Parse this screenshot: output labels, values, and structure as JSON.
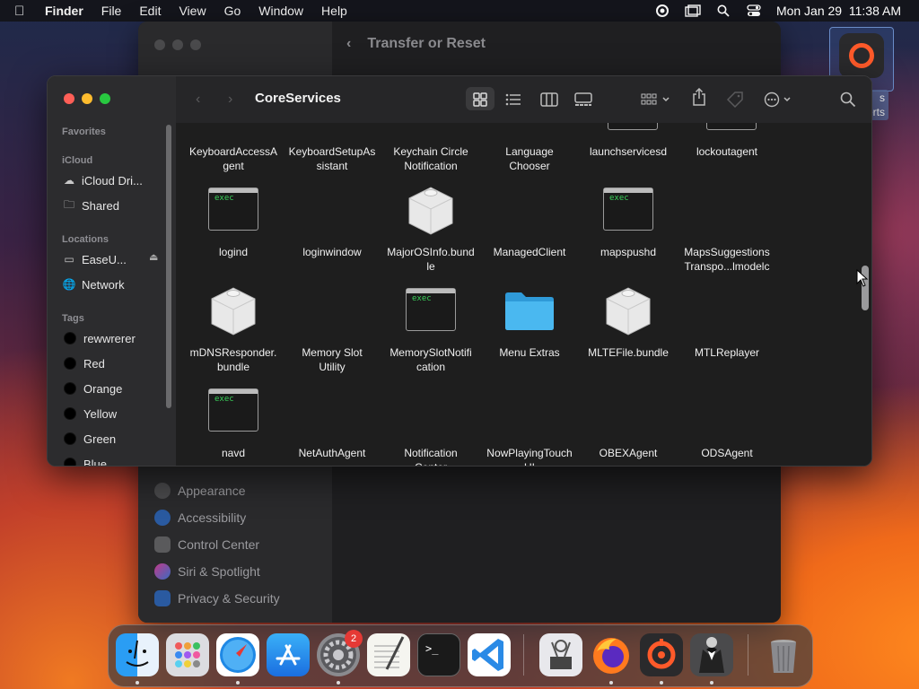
{
  "menubar": {
    "app": "Finder",
    "items": [
      "File",
      "Edit",
      "View",
      "Go",
      "Window",
      "Help"
    ],
    "datetime": "Mon Jan 29  11:38 AM"
  },
  "settings_window": {
    "header": "Transfer or Reset",
    "items": [
      "Appearance",
      "Accessibility",
      "Control Center",
      "Siri & Spotlight",
      "Privacy & Security"
    ]
  },
  "desktop_icon": {
    "label_line1": "s",
    "label_line2": "erts"
  },
  "finder": {
    "title": "CoreServices",
    "sidebar": {
      "favorites_header": "Favorites",
      "icloud_header": "iCloud",
      "icloud_items": [
        "iCloud Dri...",
        "Shared"
      ],
      "locations_header": "Locations",
      "location_items": [
        "EaseU...",
        "Network"
      ],
      "tags_header": "Tags",
      "tags": [
        "rewwrerer",
        "Red",
        "Orange",
        "Yellow",
        "Green",
        "Blue"
      ]
    },
    "rows": [
      [
        "KeyboardAccessAgent",
        "KeyboardSetupAssistant",
        "Keychain Circle Notification",
        "Language Chooser",
        "launchservicesd",
        "lockoutagent"
      ],
      [
        "logind",
        "loginwindow",
        "MajorOSInfo.bundle",
        "ManagedClient",
        "mapspushd",
        "MapsSuggestionsTranspo...lmodelc"
      ],
      [
        "mDNSResponder.bundle",
        "Memory Slot Utility",
        "MemorySlotNotification",
        "Menu Extras",
        "MLTEFile.bundle",
        "MTLReplayer"
      ],
      [
        "navd",
        "NetAuthAgent",
        "Notification Center",
        "NowPlayingTouchUI",
        "OBEXAgent",
        "ODSAgent"
      ]
    ],
    "row_labels": [
      [
        "KeyboardAccessA\ngent",
        "KeyboardSetupAs\nsistant",
        "Keychain Circle\nNotification",
        "Language\nChooser",
        "launchservicesd",
        "lockoutagent"
      ],
      [
        "logind",
        "loginwindow",
        "MajorOSInfo.bund\nle",
        "ManagedClient",
        "mapspushd",
        "MapsSuggestions\nTranspo...lmodelc"
      ],
      [
        "mDNSResponder.\nbundle",
        "Memory Slot\nUtility",
        "MemorySlotNotifi\ncation",
        "Menu Extras",
        "MLTEFile.bundle",
        "MTLReplayer"
      ],
      [
        "navd",
        "NetAuthAgent",
        "Notification\nCenter",
        "NowPlayingTouch\nUI",
        "OBEXAgent",
        "ODSAgent"
      ]
    ],
    "exec_label": "exec"
  },
  "dock": {
    "apps": [
      "Finder",
      "Launchpad",
      "Safari",
      "App Store",
      "System Settings",
      "TextEdit",
      "Terminal",
      "Visual Studio Code",
      "System Information",
      "Firefox",
      "EaseUS",
      "Bartender",
      "Trash"
    ],
    "settings_badge": "2"
  },
  "colors": {
    "close": "#ff5f57",
    "minimize": "#febc2e",
    "zoom": "#28c840",
    "folder": "#3ab0f0"
  }
}
